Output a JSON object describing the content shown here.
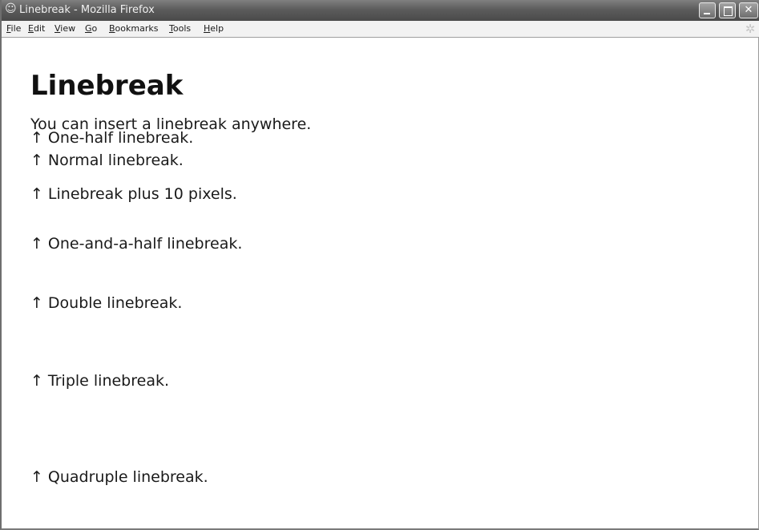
{
  "window": {
    "title": "Linebreak - Mozilla Firefox",
    "app_icon": "firefox-icon",
    "controls": {
      "minimize_icon": "minimize-icon",
      "maximize_icon": "maximize-icon",
      "close_glyph": "✕"
    },
    "throbber_glyph": "✲"
  },
  "menubar": {
    "items": [
      {
        "label": "File"
      },
      {
        "label": "Edit"
      },
      {
        "label": "View"
      },
      {
        "label": "Go"
      },
      {
        "label": "Bookmarks"
      },
      {
        "label": "Tools"
      },
      {
        "label": "Help"
      }
    ]
  },
  "page": {
    "heading": "Linebreak",
    "intro": "You can insert a linebreak anywhere.",
    "arrow": "↑",
    "lines": [
      "One-half linebreak.",
      "Normal linebreak.",
      "Linebreak plus 10 pixels.",
      "One-and-a-half linebreak.",
      "Double linebreak.",
      "Triple linebreak.",
      "Quadruple linebreak."
    ]
  }
}
